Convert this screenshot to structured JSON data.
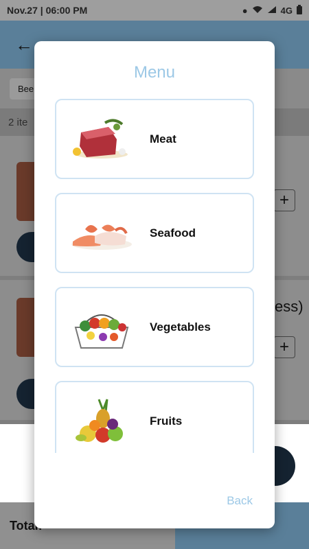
{
  "status_bar": {
    "time": "Nov.27 | 06:00 PM",
    "network": "4G"
  },
  "background": {
    "tab_chip": "Bee",
    "item_count": "2 ite",
    "item_text": "ess)",
    "total_label": "Total:"
  },
  "dialog": {
    "title": "Menu",
    "back_label": "Back",
    "items": [
      {
        "label": "Meat",
        "icon": "meat-image"
      },
      {
        "label": "Seafood",
        "icon": "seafood-image"
      },
      {
        "label": "Vegetables",
        "icon": "vegetables-image"
      },
      {
        "label": "Fruits",
        "icon": "fruits-image"
      }
    ]
  },
  "colors": {
    "accent": "#9cc8e6",
    "card_border": "#cfe3f3"
  }
}
